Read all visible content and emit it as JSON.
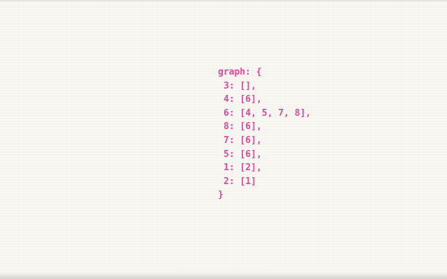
{
  "graph": {
    "open_line": "graph: {",
    "entries": [
      "3: [],",
      "4: [6],",
      "6: [4, 5, 7, 8],",
      "8: [6],",
      "7: [6],",
      "5: [6],",
      "1: [2],",
      "2: [1]"
    ],
    "close_line": "}"
  },
  "colors": {
    "background": "#f7f6f0",
    "text": "#e0489a"
  }
}
